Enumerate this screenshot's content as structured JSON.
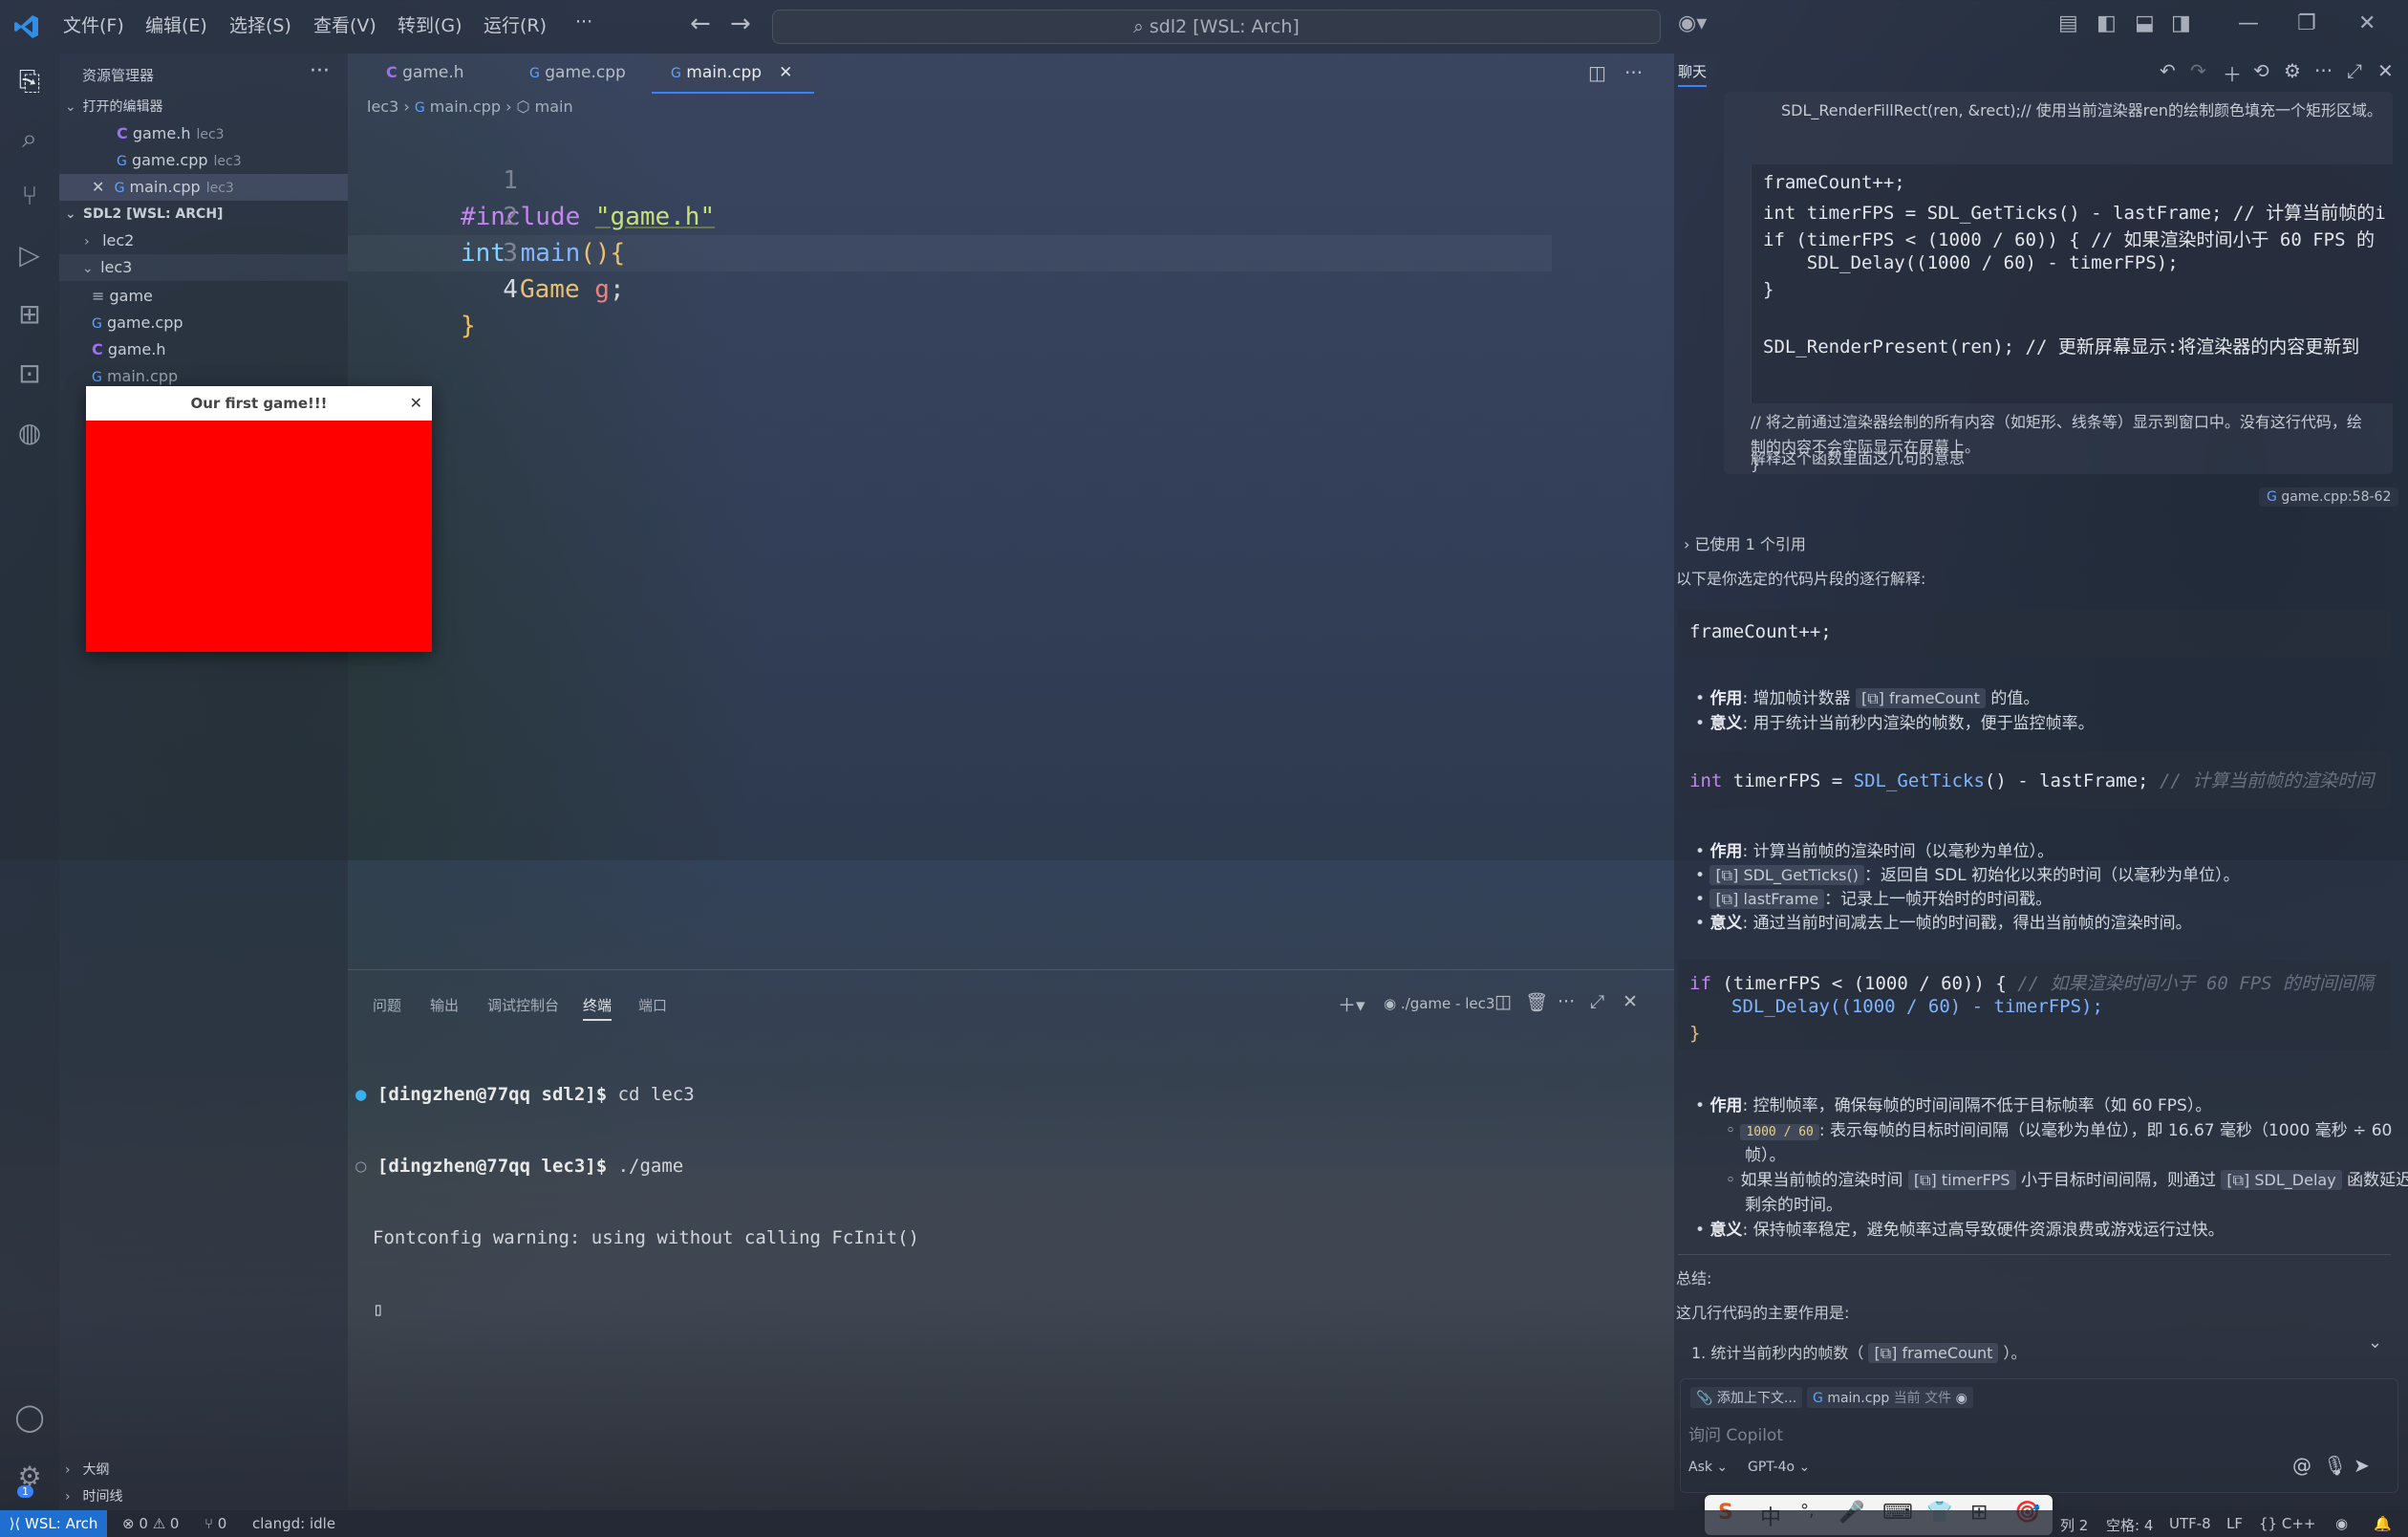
{
  "titlebar": {
    "menus": [
      "文件(F)",
      "编辑(E)",
      "选择(S)",
      "查看(V)",
      "转到(G)",
      "运行(R)",
      "···"
    ],
    "search": "sdl2 [WSL: Arch]"
  },
  "sidebar": {
    "title": "资源管理器",
    "open_editors_label": "打开的编辑器",
    "open_editors": [
      {
        "name": "game.h",
        "desc": "lec3"
      },
      {
        "name": "game.cpp",
        "desc": "lec3"
      },
      {
        "name": "main.cpp",
        "desc": "lec3"
      }
    ],
    "workspace_label": "SDL2 [WSL: ARCH]",
    "tree": [
      "lec2",
      "lec3",
      "game",
      "game.cpp",
      "game.h",
      "main.cpp"
    ],
    "outline_label": "大纲",
    "timeline_label": "时间线"
  },
  "sdl_window": {
    "title": "Our first game!!!",
    "canvas_color": "#ff0000"
  },
  "editor": {
    "tabs": [
      "game.h",
      "game.cpp",
      "main.cpp"
    ],
    "active_tab": "main.cpp",
    "breadcrumb": [
      "lec3",
      "main.cpp",
      "main"
    ],
    "line_numbers": [
      "1",
      "2",
      "3",
      "4"
    ],
    "code": {
      "l1_kw": "#include",
      "l1_str": "\"game.h\"",
      "l2_type": "int",
      "l2_fn": "main",
      "l2_punc": "(){",
      "l3_type": "Game",
      "l3_var": "g",
      "l3_end": ";",
      "l4": "}"
    }
  },
  "panel": {
    "tabs": [
      "问题",
      "输出",
      "调试控制台",
      "终端",
      "端口"
    ],
    "active_tab": "终端",
    "terminal_name": "./game - lec3",
    "lines": [
      {
        "user": "[dingzhen@77qq",
        "dir": "sdl2]$",
        "cmd": "cd lec3"
      },
      {
        "user": "[dingzhen@77qq",
        "dir": "lec3]$",
        "cmd": "./game"
      }
    ],
    "output": "Fontconfig warning: using without calling FcInit()"
  },
  "chat": {
    "title": "聊天",
    "prev_code_top": "SDL_RenderFillRect(ren, &rect);// 使用当前渲染器ren的绘制颜色填充一个矩形区域。",
    "user_code": [
      "frameCount++;",
      "int timerFPS = SDL_GetTicks() - lastFrame; // 计算当前帧的i",
      "if (timerFPS < (1000 / 60)) { // 如果渲染时间小于 60 FPS 的",
      "    SDL_Delay((1000 / 60) - timerFPS);",
      "}",
      "",
      "SDL_RenderPresent(ren); // 更新屏幕显示:将渲染器的内容更新到"
    ],
    "user_note_1": "// 将之前通过渲染器绘制的所有内容（如矩形、线条等）显示到窗口中。没有这行代码，绘",
    "user_note_2": "制的内容不会实际显示在屏幕上。",
    "user_note_3": "}",
    "user_question": "解释这个函数里面这几句的意思",
    "ref_chip": "game.cpp:58-62",
    "used_refs": "已使用 1 个引用",
    "intro": "以下是你选定的代码片段的逐行解释:",
    "block1": "frameCount++;",
    "b1_role_label": "作用",
    "b1_role": ": 增加帧计数器",
    "b1_role_chip": "frameCount",
    "b1_role_tail": "的值。",
    "b1_meaning_label": "意义",
    "b1_meaning": ": 用于统计当前秒内渲染的帧数，便于监控帧率。",
    "block2_kw": "int",
    "block2_a": "timerFPS =",
    "block2_fn": "SDL_GetTicks",
    "block2_b": "() - lastFrame;",
    "block2_comment": "// 计算当前帧的渲染时间",
    "b2_role_label": "作用",
    "b2_role": ": 计算当前帧的渲染时间（以毫秒为单位）。",
    "b2_sub1_chip": "SDL_GetTicks()",
    "b2_sub1": "：返回自 SDL 初始化以来的时间（以毫秒为单位）。",
    "b2_sub2_chip": "lastFrame",
    "b2_sub2": "：记录上一帧开始时的时间戳。",
    "b2_meaning_label": "意义",
    "b2_meaning": ": 通过当前时间减去上一帧的时间戳，得出当前帧的渲染时间。",
    "block3_l1_kw": "if",
    "block3_l1": "(timerFPS < (1000 / 60)) {",
    "block3_l1_comment": "// 如果渲染时间小于 60 FPS 的时间间隔",
    "block3_l2": "SDL_Delay((1000 / 60) - timerFPS);",
    "block3_l3": "}",
    "b3_role_label": "作用",
    "b3_role": ": 控制帧率，确保每帧的时间间隔不低于目标帧率（如 60 FPS）。",
    "b3_sub1_chip": "1000 / 60",
    "b3_sub1": ": 表示每帧的目标时间间隔（以毫秒为单位），即 16.67 毫秒（1000 毫秒 ÷ 60",
    "b3_sub1b": "帧）。",
    "b3_sub2_pre": "如果当前帧的渲染时间",
    "b3_sub2_chip1": "timerFPS",
    "b3_sub2_mid": "小于目标时间间隔，则通过",
    "b3_sub2_chip2": "SDL_Delay",
    "b3_sub2_tail": "函数延迟",
    "b3_sub2b": "剩余的时间。",
    "b3_meaning_label": "意义",
    "b3_meaning": ": 保持帧率稳定，避免帧率过高导致硬件资源浪费或游戏运行过快。",
    "summary_label": "总结:",
    "summary_intro": "这几行代码的主要作用是:",
    "summary_item1_pre": "1. 统计当前秒内的帧数（",
    "summary_item1_chip": "frameCount",
    "summary_item1_tail": "）。",
    "add_context": "添加上下文...",
    "current_file": "main.cpp",
    "current_file_desc": "当前 文件",
    "input_placeholder": "询问 Copilot",
    "mode": "Ask",
    "model": "GPT-4o"
  },
  "ime": {
    "items": [
      "S",
      "中",
      "°,",
      "🎤",
      "⌨",
      "👕",
      "⊞",
      "🎯"
    ]
  },
  "statusbar": {
    "remote": "WSL: Arch",
    "errors": "0",
    "warnings": "0",
    "ports": "0",
    "clangd": "clangd: idle",
    "col": "列 2",
    "spaces": "空格: 4",
    "encoding": "UTF-8",
    "eol": "LF",
    "lang": "C++",
    "notif": "1"
  }
}
